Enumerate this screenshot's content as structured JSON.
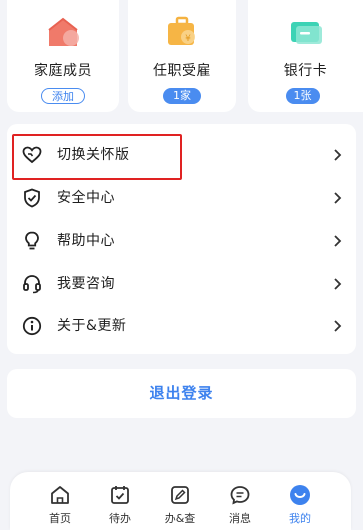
{
  "cards": [
    {
      "title": "家庭成员",
      "badge": "添加",
      "icon": "house-icon"
    },
    {
      "title": "任职受雇",
      "badge": "1家",
      "icon": "briefcase-icon"
    },
    {
      "title": "银行卡",
      "badge": "1张",
      "icon": "bank-card-icon"
    }
  ],
  "menu": {
    "items": [
      {
        "label": "切换关怀版",
        "icon": "heart-icon"
      },
      {
        "label": "安全中心",
        "icon": "shield-check-icon"
      },
      {
        "label": "帮助中心",
        "icon": "lightbulb-icon"
      },
      {
        "label": "我要咨询",
        "icon": "headset-icon"
      },
      {
        "label": "关于&更新",
        "icon": "info-icon"
      }
    ]
  },
  "logout": {
    "label": "退出登录"
  },
  "nav": {
    "items": [
      {
        "label": "首页",
        "icon": "home-icon"
      },
      {
        "label": "待办",
        "icon": "calendar-check-icon"
      },
      {
        "label": "办&查",
        "icon": "edit-document-icon"
      },
      {
        "label": "消息",
        "icon": "chat-icon"
      },
      {
        "label": "我的",
        "icon": "profile-smile-icon"
      }
    ],
    "active_index": 4
  },
  "colors": {
    "accent": "#3d82ee",
    "highlight": "#e02222",
    "background": "#f3f4f8"
  }
}
